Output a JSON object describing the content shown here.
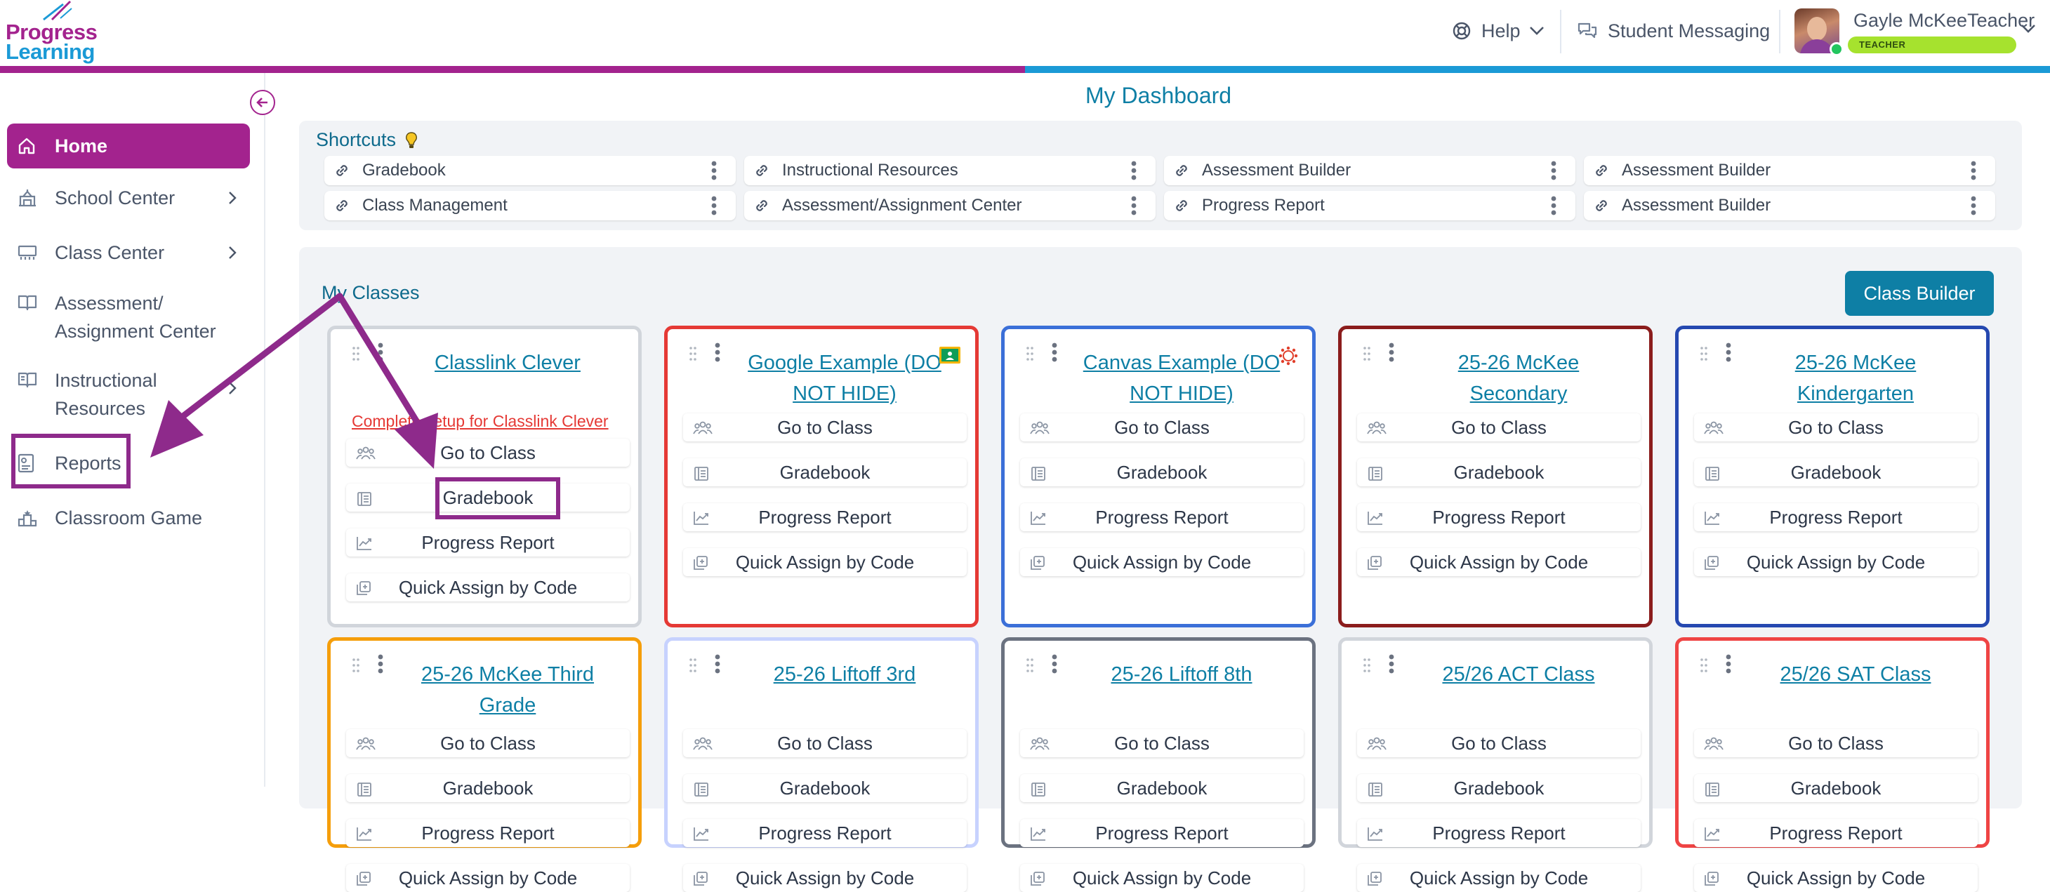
{
  "logo": {
    "line1": "Progress",
    "line2": "Learning"
  },
  "header": {
    "help_label": "Help",
    "messaging_label": "Student Messaging",
    "user_name": "Gayle McKeeTeacher",
    "user_role": "TEACHER"
  },
  "sidebar": {
    "items": [
      {
        "label": "Home",
        "icon": "home-icon"
      },
      {
        "label": "School Center",
        "icon": "school-icon"
      },
      {
        "label": "Class Center",
        "icon": "classroom-icon"
      },
      {
        "label_line1": "Assessment/",
        "label_line2": "Assignment Center",
        "icon": "book-open-icon"
      },
      {
        "label_line1": "Instructional",
        "label_line2": "Resources",
        "icon": "book-icon"
      },
      {
        "label": "Reports",
        "icon": "report-icon"
      },
      {
        "label": "Classroom Game",
        "icon": "podium-icon"
      }
    ]
  },
  "main": {
    "title": "My Dashboard",
    "shortcuts_title": "Shortcuts",
    "shortcuts": [
      "Gradebook",
      "Instructional Resources",
      "Assessment Builder",
      "Assessment Builder",
      "Class Management",
      "Assessment/Assignment Center",
      "Progress Report",
      "Assessment Builder"
    ],
    "classes_title": "My Classes",
    "class_builder_label": "Class Builder",
    "buttons": {
      "go_to_class": "Go to Class",
      "gradebook": "Gradebook",
      "progress_report": "Progress Report",
      "quick_assign": "Quick Assign by Code"
    },
    "classes_row1": [
      {
        "name": "Classlink Clever",
        "setup": "Complete setup for Classlink Clever",
        "border": "#d1d5db"
      },
      {
        "name": "Google Example (DO NOT HIDE)",
        "border": "#e53935"
      },
      {
        "name": "Canvas Example (DO NOT HIDE)",
        "border": "#3b6fd8"
      },
      {
        "name": "25-26 McKee Secondary",
        "border": "#8b1c1c"
      },
      {
        "name": "25-26 McKee Kindergarten",
        "border": "#2548b0"
      }
    ],
    "classes_row2": [
      {
        "name": "25-26 McKee Third Grade",
        "border": "#f59e0b"
      },
      {
        "name": "25-26 Liftoff 3rd",
        "border": "#c7d2fe"
      },
      {
        "name": "25-26 Liftoff 8th",
        "border": "#6b7280"
      },
      {
        "name": "25/26 ACT Class",
        "border": "#d1d5db"
      },
      {
        "name": "25/26 SAT Class",
        "border": "#ef4444"
      }
    ]
  },
  "colors": {
    "brand_purple": "#a3238e",
    "brand_blue": "#1b9ad6",
    "link_teal": "#0e7fa5",
    "annotation_purple": "#8e2a8b"
  }
}
